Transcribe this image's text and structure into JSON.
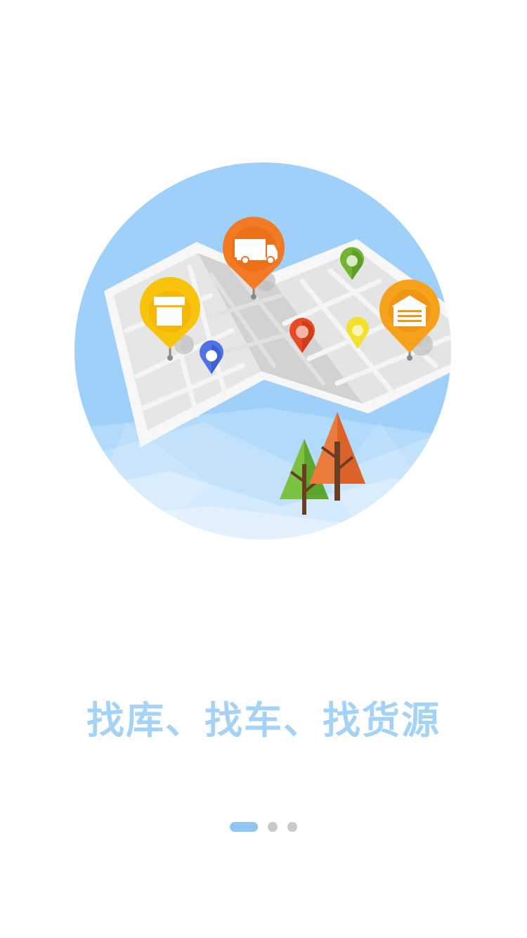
{
  "onboarding": {
    "tagline": "找库、找车、找货源",
    "current_page": 1,
    "total_pages": 3
  },
  "icons": {
    "warehouse_pin": "warehouse-pin-icon",
    "truck_pin": "truck-pin-icon",
    "package_pin": "package-pin-icon",
    "map": "folded-map-icon",
    "trees": "trees-icon"
  },
  "colors": {
    "tagline": "#a4d3f7",
    "circle": "#9fd0fa",
    "pin_orange": "#f27a24",
    "pin_yellow": "#f8c30b",
    "pin_amber": "#f5a11c",
    "pin_red": "#e84b23",
    "pin_blue": "#4f73e6",
    "pin_green": "#73b533",
    "dot_active": "#8fc6f3",
    "dot_inactive": "#c9c9c9"
  }
}
